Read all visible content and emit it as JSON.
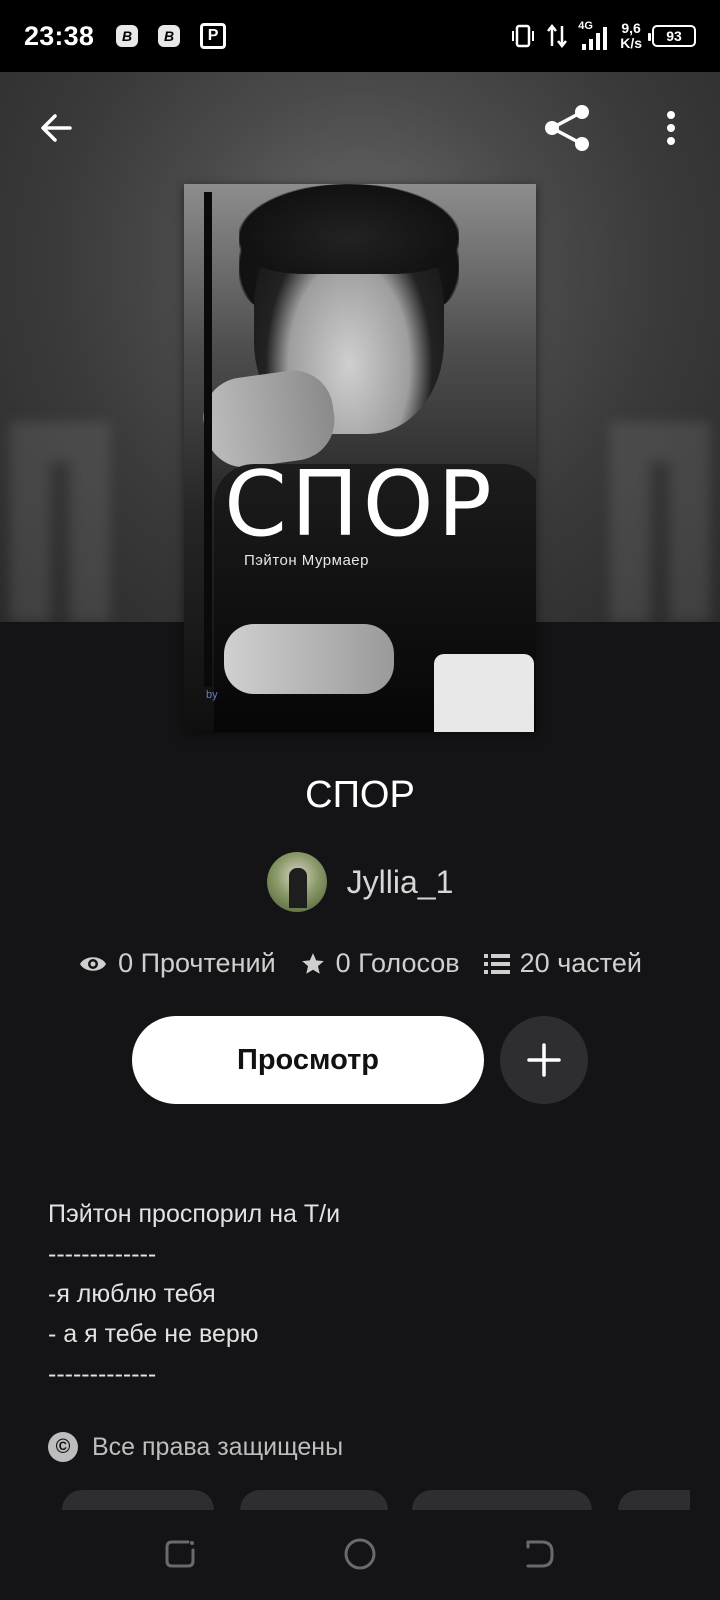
{
  "status_bar": {
    "time": "23:38",
    "notif_1": "B",
    "notif_2": "B",
    "notif_3": "P",
    "signal": "4G",
    "net_speed_value": "9,6",
    "net_speed_unit": "K/s",
    "battery": "93"
  },
  "icons": {
    "back": "arrow-left-icon",
    "share": "share-icon",
    "more": "more-vertical-icon",
    "views": "eye-icon",
    "votes": "star-icon",
    "parts": "list-icon",
    "add": "plus-icon",
    "copyright": "copyright-icon"
  },
  "cover": {
    "title": "СПОР",
    "author": "Пэйтон Мурмаер",
    "mark": "by"
  },
  "story": {
    "title": "СПОР",
    "author": "Jyllia_1",
    "reads": "0 Прочтений",
    "votes": "0 Голосов",
    "parts": "20 частей"
  },
  "actions": {
    "read_label": "Просмотр"
  },
  "description": [
    "Пэйтон проспорил на Т/и",
    "-------------",
    "-я люблю тебя",
    "- а я тебе не верю",
    "-------------"
  ],
  "copyright": {
    "symbol": "©",
    "text": "Все права защищены"
  },
  "colors": {
    "background": "#141316",
    "status_bar": "#000000",
    "button_primary": "#ffffff",
    "button_secondary": "#2e2d31"
  }
}
